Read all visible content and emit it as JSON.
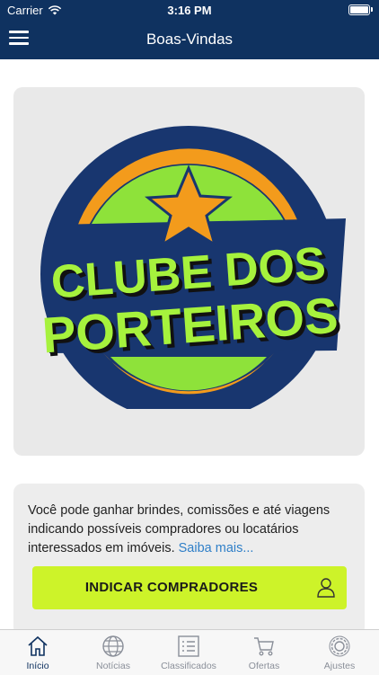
{
  "status_bar": {
    "carrier": "Carrier",
    "time": "3:16 PM"
  },
  "navbar": {
    "title": "Boas-Vindas"
  },
  "logo": {
    "line1": "CLUBE DOS",
    "line2": "PORTEIROS"
  },
  "info": {
    "text": "Você pode ganhar brindes, comissões e até viagens indicando possíveis compradores ou locatários interessados em imóveis.",
    "more_link": "Saiba mais..."
  },
  "cta": {
    "label": "INDICAR COMPRADORES"
  },
  "tabs": [
    {
      "label": "Início",
      "icon": "home-icon"
    },
    {
      "label": "Notícias",
      "icon": "globe-icon"
    },
    {
      "label": "Classificados",
      "icon": "list-icon"
    },
    {
      "label": "Ofertas",
      "icon": "cart-icon"
    },
    {
      "label": "Ajustes",
      "icon": "gear-icon"
    }
  ],
  "colors": {
    "navbar": "#0f3260",
    "accent": "#cdf329",
    "link": "#2f7fc8"
  }
}
